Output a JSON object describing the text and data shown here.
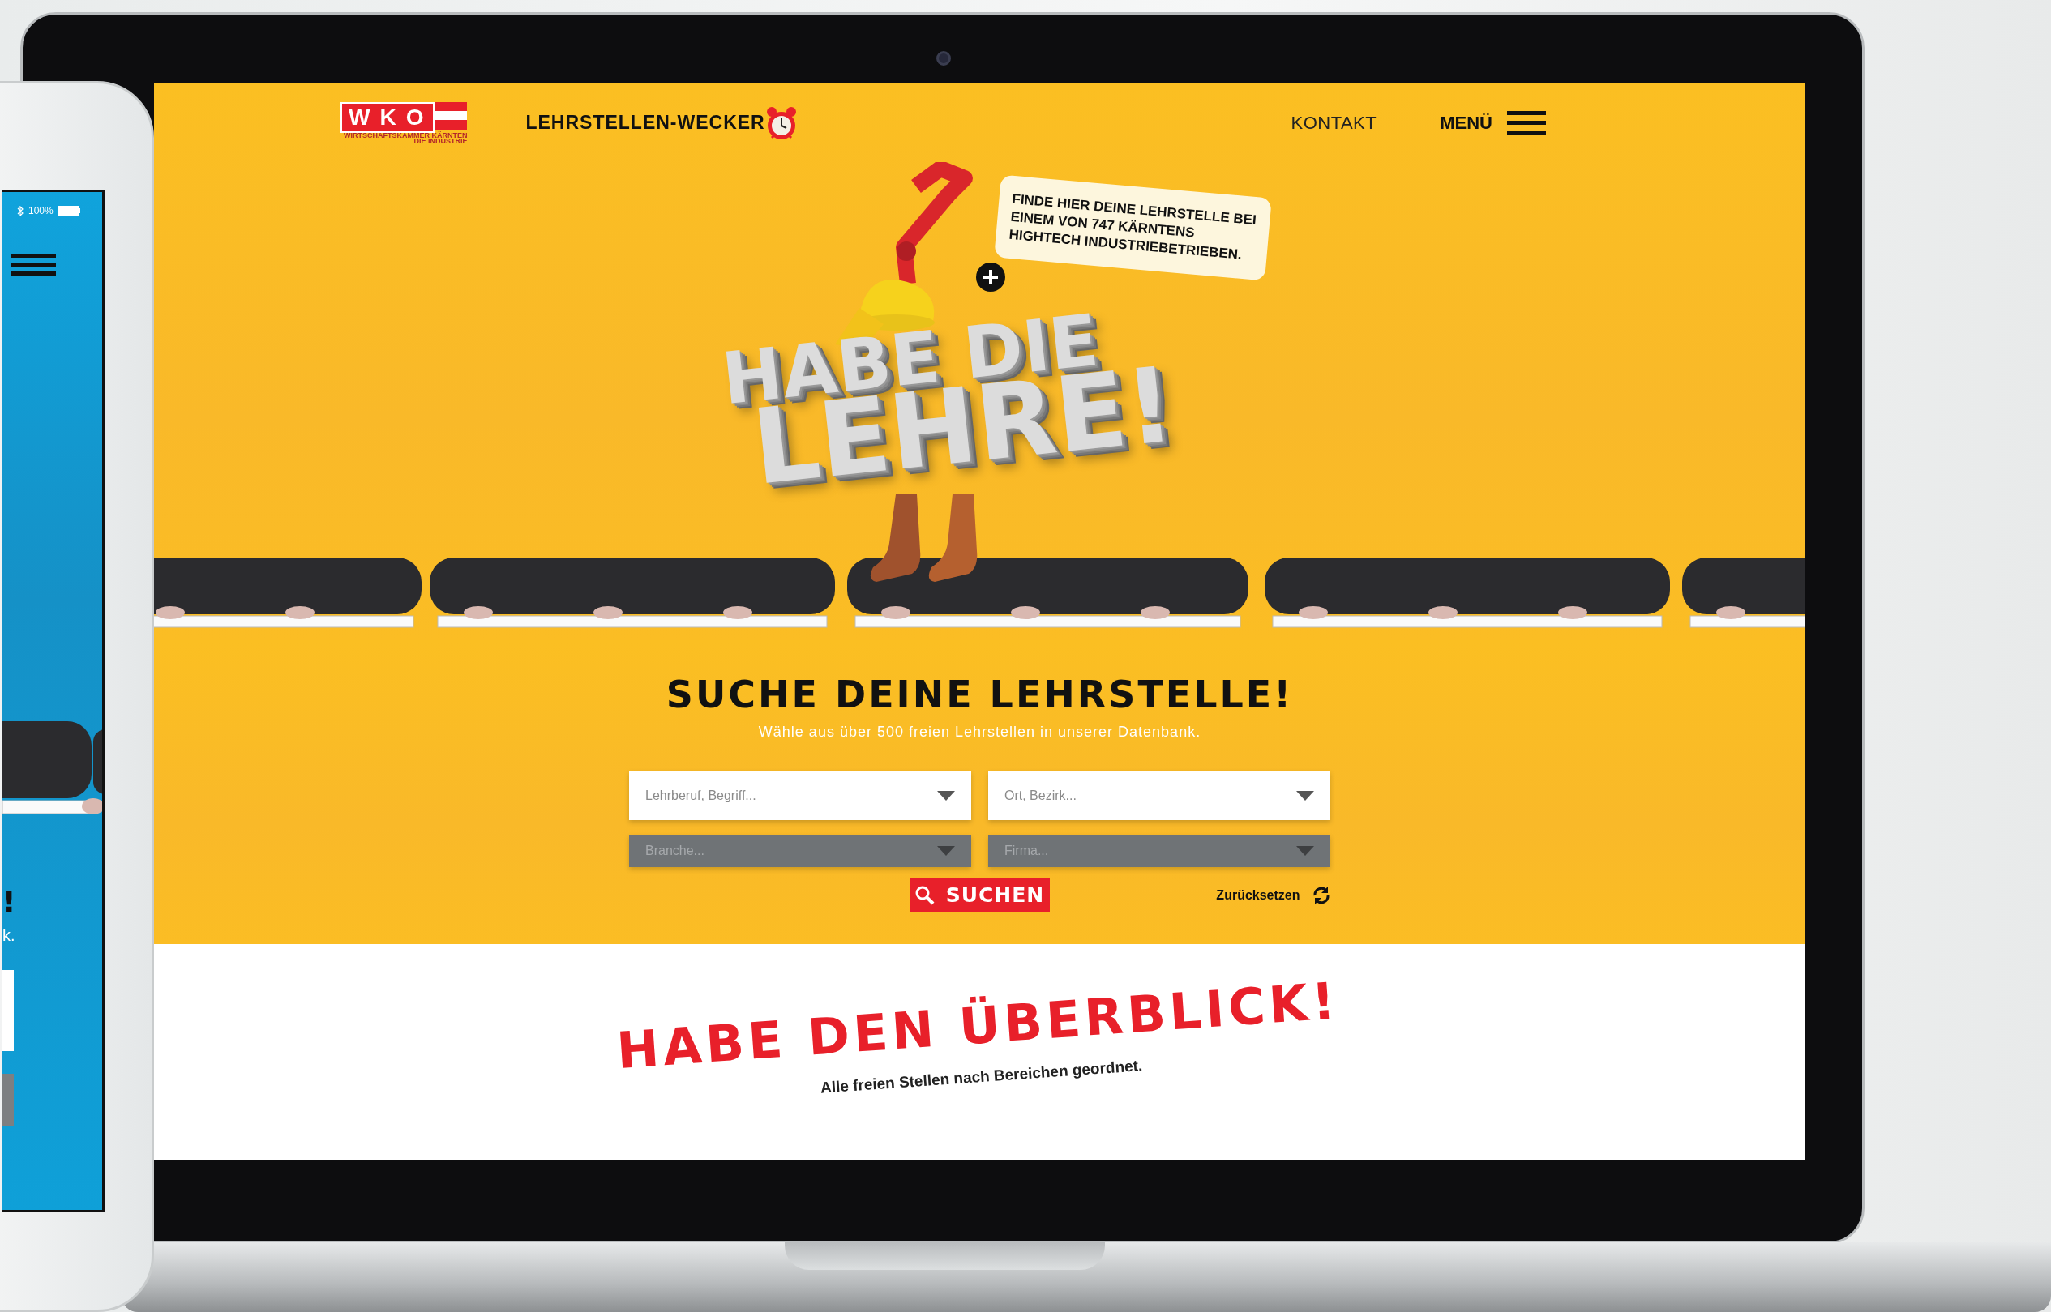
{
  "laptop_screen": {
    "header": {
      "logo": {
        "text": "WKO",
        "tagline_1": "WIRTSCHAFTSKAMMER KÄRNTEN",
        "tagline_2": "DIE INDUSTRIE"
      },
      "site_title": "LEHRSTELLEN-WECKER",
      "nav": [
        {
          "label": "KONTAKT",
          "kind": "link"
        },
        {
          "label": "MENÜ",
          "kind": "menu"
        }
      ]
    },
    "hero": {
      "speech_bubble": "FINDE HIER DEINE LEHRSTELLE BEI EINEM VON 747 KÄRNTENS HIGHTECH INDUSTRIEBETRIEBEN.",
      "headline_1": "HABE DIE",
      "headline_2": "LEHRE!"
    },
    "search": {
      "title": "SUCHE DEINE LEHRSTELLE!",
      "subtitle": "Wähle aus über 500 freien Lehrstellen in unserer Datenbank.",
      "fields": [
        {
          "placeholder": "Lehrberuf, Begriff...",
          "disabled": false
        },
        {
          "placeholder": "Ort, Bezirk...",
          "disabled": false
        },
        {
          "placeholder": "Branche...",
          "disabled": true
        },
        {
          "placeholder": "Firma...",
          "disabled": true
        }
      ],
      "submit": "SUCHEN",
      "reset": "Zurücksetzen"
    },
    "overview": {
      "title": "HABE DEN ÜBERBLICK!",
      "subtitle": "Alle freien Stellen nach Bereichen geordnet."
    }
  },
  "tablet_screen": {
    "battery": "100%",
    "headline_fragment": "!",
    "subtitle_fragment": "k."
  }
}
